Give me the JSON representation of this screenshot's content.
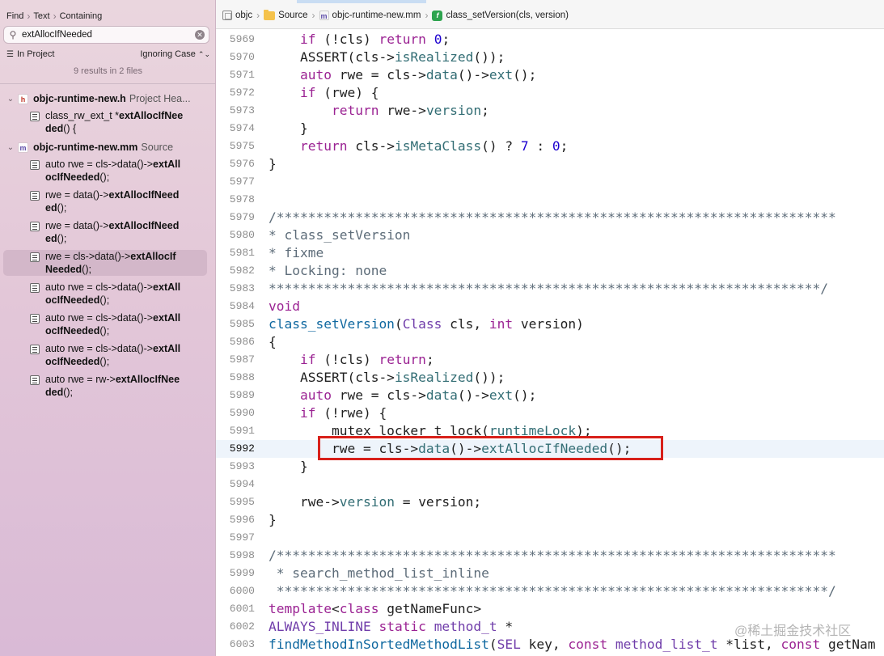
{
  "navigator": {
    "find_mode": [
      "Find",
      "Text",
      "Containing"
    ],
    "search_value": "extAllocIfNeeded",
    "scope": "In Project",
    "case_option": "Ignoring Case",
    "summary": "9 results in 2 files",
    "files": [
      {
        "name": "objc-runtime-new.h",
        "kind": "Project Hea...",
        "badge": "h",
        "badge_color": "#c0392b",
        "results": [
          {
            "prefix": "class_rw_ext_t *",
            "match_a": "extAllocIfNee",
            "match_b": "ded",
            "suffix_b": "() {"
          }
        ]
      },
      {
        "name": "objc-runtime-new.mm",
        "kind": "Source",
        "badge": "m",
        "badge_color": "#5b4aa8",
        "results": [
          {
            "prefix": "auto rwe = cls->data()->",
            "match_a": "extAll",
            "match_b": "ocIfNeeded",
            "suffix_b": "();"
          },
          {
            "prefix": "rwe = data()->",
            "match_a": "extAllocIfNeed",
            "match_b": "ed",
            "suffix_b": "();"
          },
          {
            "prefix": "rwe = data()->",
            "match_a": "extAllocIfNeed",
            "match_b": "ed",
            "suffix_b": "();"
          },
          {
            "prefix": "rwe = cls->data()->",
            "match_a": "extAllocIf",
            "match_b": "Needed",
            "suffix_b": "();"
          },
          {
            "prefix": "auto rwe = cls->data()->",
            "match_a": "extAll",
            "match_b": "ocIfNeeded",
            "suffix_b": "();"
          },
          {
            "prefix": "auto rwe = cls->data()->",
            "match_a": "extAll",
            "match_b": "ocIfNeeded",
            "suffix_b": "();"
          },
          {
            "prefix": "auto rwe = cls->data()->",
            "match_a": "extAll",
            "match_b": "ocIfNeeded",
            "suffix_b": "();"
          },
          {
            "prefix": "auto rwe = rw->",
            "match_a": "extAllocIfNee",
            "match_b": "ded",
            "suffix_b": "();"
          }
        ]
      }
    ]
  },
  "jumpbar": {
    "crumbs": [
      {
        "label": "objc",
        "icon": "project-icon"
      },
      {
        "label": "Source",
        "icon": "folder-icon"
      },
      {
        "label": "objc-runtime-new.mm",
        "icon": "objc-source-file-icon"
      },
      {
        "label": "class_setVersion(cls, version)",
        "icon": "function-icon"
      }
    ]
  },
  "editor": {
    "current_line": "5992",
    "lines": [
      {
        "n": "5969",
        "t": [
          [
            "    ",
            ""
          ],
          [
            "if",
            "kw"
          ],
          [
            " (!cls) ",
            ""
          ],
          [
            "return",
            "kw"
          ],
          [
            " ",
            ""
          ],
          [
            "0",
            "num"
          ],
          [
            ";",
            ""
          ]
        ]
      },
      {
        "n": "5970",
        "t": [
          [
            "    ASSERT(cls->",
            ""
          ],
          [
            "isRealized",
            "fn"
          ],
          [
            "());",
            ""
          ]
        ]
      },
      {
        "n": "5971",
        "t": [
          [
            "    ",
            ""
          ],
          [
            "auto",
            "kw"
          ],
          [
            " rwe = cls->",
            ""
          ],
          [
            "data",
            "fn"
          ],
          [
            "()->",
            ""
          ],
          [
            "ext",
            "fn"
          ],
          [
            "();",
            ""
          ]
        ]
      },
      {
        "n": "5972",
        "t": [
          [
            "    ",
            ""
          ],
          [
            "if",
            "kw"
          ],
          [
            " (rwe) {",
            ""
          ]
        ]
      },
      {
        "n": "5973",
        "t": [
          [
            "        ",
            ""
          ],
          [
            "return",
            "kw"
          ],
          [
            " rwe->",
            ""
          ],
          [
            "version",
            "fn"
          ],
          [
            ";",
            ""
          ]
        ]
      },
      {
        "n": "5974",
        "t": [
          [
            "    }",
            ""
          ]
        ]
      },
      {
        "n": "5975",
        "t": [
          [
            "    ",
            ""
          ],
          [
            "return",
            "kw"
          ],
          [
            " cls->",
            ""
          ],
          [
            "isMetaClass",
            "fn"
          ],
          [
            "() ? ",
            ""
          ],
          [
            "7",
            "num"
          ],
          [
            " : ",
            ""
          ],
          [
            "0",
            "num"
          ],
          [
            ";",
            ""
          ]
        ]
      },
      {
        "n": "5976",
        "t": [
          [
            "}",
            ""
          ]
        ]
      },
      {
        "n": "5977",
        "t": []
      },
      {
        "n": "5978",
        "t": []
      },
      {
        "n": "5979",
        "t": [
          [
            "/***********************************************************************",
            "cm"
          ]
        ]
      },
      {
        "n": "5980",
        "t": [
          [
            "* class_setVersion",
            "cm"
          ]
        ]
      },
      {
        "n": "5981",
        "t": [
          [
            "* fixme",
            "cm"
          ]
        ]
      },
      {
        "n": "5982",
        "t": [
          [
            "* Locking: none",
            "cm"
          ]
        ]
      },
      {
        "n": "5983",
        "t": [
          [
            "**********************************************************************/",
            "cm"
          ]
        ]
      },
      {
        "n": "5984",
        "t": [
          [
            "void",
            "kw"
          ]
        ]
      },
      {
        "n": "5985",
        "t": [
          [
            "class_setVersion",
            "decl"
          ],
          [
            "(",
            ""
          ],
          [
            "Class",
            "ty"
          ],
          [
            " cls, ",
            ""
          ],
          [
            "int",
            "kw"
          ],
          [
            " version)",
            ""
          ]
        ]
      },
      {
        "n": "5986",
        "t": [
          [
            "{",
            ""
          ]
        ]
      },
      {
        "n": "5987",
        "t": [
          [
            "    ",
            ""
          ],
          [
            "if",
            "kw"
          ],
          [
            " (!cls) ",
            ""
          ],
          [
            "return",
            "kw"
          ],
          [
            ";",
            ""
          ]
        ]
      },
      {
        "n": "5988",
        "t": [
          [
            "    ASSERT(cls->",
            ""
          ],
          [
            "isRealized",
            "fn"
          ],
          [
            "());",
            ""
          ]
        ]
      },
      {
        "n": "5989",
        "t": [
          [
            "    ",
            ""
          ],
          [
            "auto",
            "kw"
          ],
          [
            " rwe = cls->",
            ""
          ],
          [
            "data",
            "fn"
          ],
          [
            "()->",
            ""
          ],
          [
            "ext",
            "fn"
          ],
          [
            "();",
            ""
          ]
        ]
      },
      {
        "n": "5990",
        "t": [
          [
            "    ",
            ""
          ],
          [
            "if",
            "kw"
          ],
          [
            " (!rwe) {",
            ""
          ]
        ]
      },
      {
        "n": "5991",
        "t": [
          [
            "        mutex_locker_t lock(",
            ""
          ],
          [
            "runtimeLock",
            "fn"
          ],
          [
            ");",
            ""
          ]
        ]
      },
      {
        "n": "5992",
        "t": [
          [
            "        rwe = cls->",
            ""
          ],
          [
            "data",
            "fn"
          ],
          [
            "()->",
            ""
          ],
          [
            "extAllocIfNeeded",
            "fn"
          ],
          [
            "();",
            ""
          ]
        ]
      },
      {
        "n": "5993",
        "t": [
          [
            "    }",
            ""
          ]
        ]
      },
      {
        "n": "5994",
        "t": []
      },
      {
        "n": "5995",
        "t": [
          [
            "    rwe->",
            ""
          ],
          [
            "version",
            "fn"
          ],
          [
            " = version;",
            ""
          ]
        ]
      },
      {
        "n": "5996",
        "t": [
          [
            "}",
            ""
          ]
        ]
      },
      {
        "n": "5997",
        "t": []
      },
      {
        "n": "5998",
        "t": [
          [
            "/***********************************************************************",
            "cm"
          ]
        ]
      },
      {
        "n": "5999",
        "t": [
          [
            " * search_method_list_inline",
            "cm"
          ]
        ]
      },
      {
        "n": "6000",
        "t": [
          [
            " **********************************************************************/",
            "cm"
          ]
        ]
      },
      {
        "n": "6001",
        "t": [
          [
            "template",
            "kw"
          ],
          [
            "<",
            ""
          ],
          [
            "class",
            "kw"
          ],
          [
            " getNameFunc>",
            ""
          ]
        ]
      },
      {
        "n": "6002",
        "t": [
          [
            "ALWAYS_INLINE",
            "ty"
          ],
          [
            " ",
            ""
          ],
          [
            "static",
            "kw"
          ],
          [
            " ",
            ""
          ],
          [
            "method_t",
            "ty"
          ],
          [
            " *",
            ""
          ]
        ]
      },
      {
        "n": "6003",
        "t": [
          [
            "findMethodInSortedMethodList",
            "decl"
          ],
          [
            "(",
            ""
          ],
          [
            "SEL",
            "ty"
          ],
          [
            " key, ",
            ""
          ],
          [
            "const",
            "kw"
          ],
          [
            " ",
            ""
          ],
          [
            "method_list_t",
            "ty"
          ],
          [
            " *list, ",
            ""
          ],
          [
            "const",
            "kw"
          ],
          [
            " getNam",
            ""
          ]
        ]
      }
    ]
  },
  "watermark": "@稀土掘金技术社区",
  "colors": {
    "highlight_border": "#d8201a",
    "keyword": "#9b2393",
    "number": "#1c00cf",
    "function": "#326d74",
    "comment": "#5d6c79"
  }
}
